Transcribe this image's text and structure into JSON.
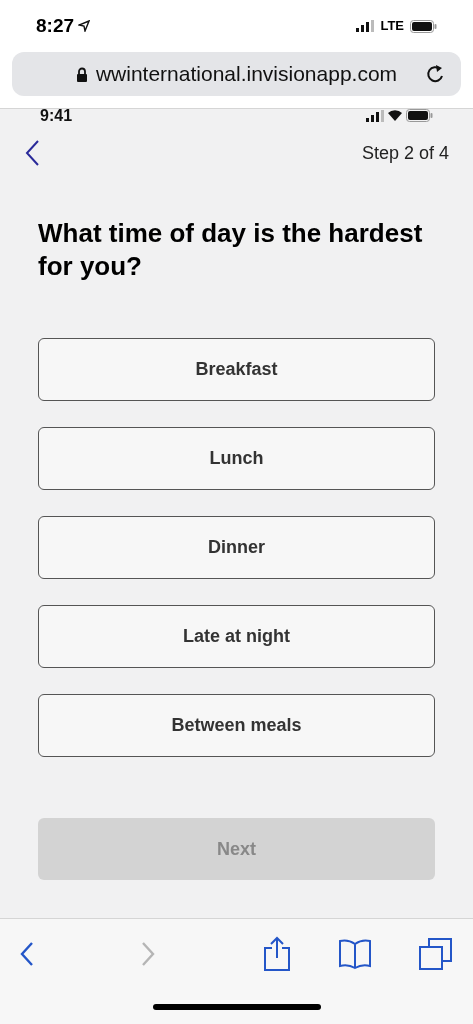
{
  "status_bar": {
    "time": "8:27",
    "network": "LTE"
  },
  "address_bar": {
    "url": "wwinternational.invisionapp.com"
  },
  "inner_status_bar": {
    "time": "9:41"
  },
  "header": {
    "step": "Step 2 of 4"
  },
  "question": "What time of day is the hardest for you?",
  "options": [
    {
      "label": "Breakfast"
    },
    {
      "label": "Lunch"
    },
    {
      "label": "Dinner"
    },
    {
      "label": "Late at night"
    },
    {
      "label": "Between meals"
    }
  ],
  "next_button": {
    "label": "Next",
    "disabled": true
  },
  "toolbar": {
    "back_disabled": false,
    "forward_disabled": true
  }
}
